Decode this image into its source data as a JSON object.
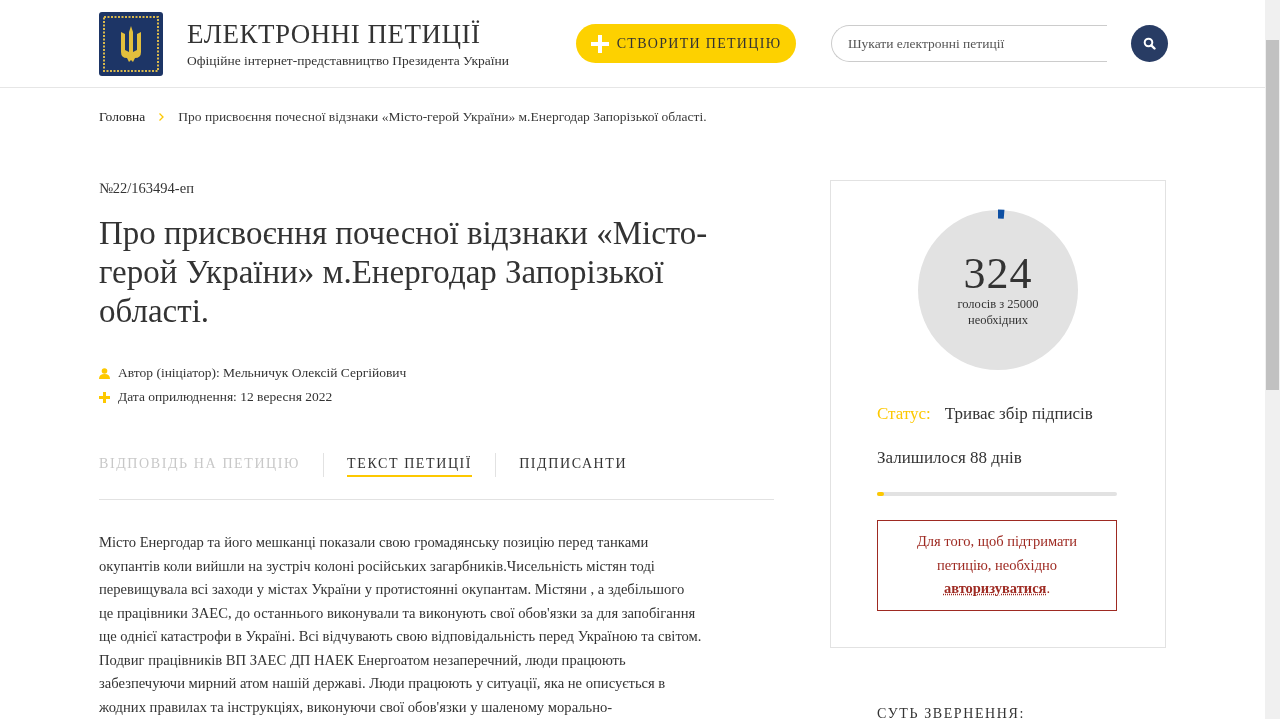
{
  "header": {
    "title": "ЕЛЕКТРОННІ ПЕТИЦІЇ",
    "subtitle": "Офіційне інтернет-представництво Президента України",
    "create_button": "СТВОРИТИ ПЕТИЦІЮ",
    "search": {
      "placeholder": "Шукати електронні петиції"
    }
  },
  "breadcrumbs": [
    {
      "label": "Головна",
      "kind": "link"
    },
    {
      "label": "Про присвоєння почесної відзнаки «Місто-герой України» м.Енергодар Запорізької області.",
      "kind": "current"
    }
  ],
  "petition": {
    "number": "№22/163494-еп",
    "title": "Про присвоєння почесної відзнаки «Місто-герой України» м.Енергодар Запорізької області.",
    "meta": [
      {
        "kind": "author",
        "text": "Автор (ініціатор): Мельничук Олексій Сергійович"
      },
      {
        "kind": "date",
        "text": "Дата оприлюднення: 12 вересня 2022"
      }
    ],
    "tabs": [
      {
        "label": "ВІДПОВІДЬ НА ПЕТИЦІЮ",
        "selected": false,
        "disabled": true
      },
      {
        "label": "ТЕКСТ ПЕТИЦІЇ",
        "selected": true,
        "disabled": false
      },
      {
        "label": "ПІДПИСАНТИ",
        "selected": false,
        "disabled": false
      }
    ],
    "text_lines": [
      "Місто Енергодар та його мешканці показали свою громадянську позицію перед танками",
      "окупантів коли вийшли на зустріч колоні російських загарбників.Чисельність містян тоді",
      "перевищувала всі заходи у містах України у протистоянні окупантам. Містяни , а здебільшого",
      "це працівники ЗАЕС, до останнього виконували та виконують свої обов'язки за для запобігання",
      "ще однієї катастрофи в Україні. Всі відчувають свою відповідальність перед Україною та світом.",
      "Подвиг працівників ВП ЗАЕС ДП НАЕК Енергоатом незаперечний, люди працюють",
      "забезпечуючи мирний атом нашій державі. Люди працюють у ситуації, яка не описується в",
      "жодних правилах та інструкціях, виконуючи свої обов'язки у шаленому морально-"
    ]
  },
  "votes": {
    "count": "324",
    "caption": "голосів з 25000 необхідних",
    "level": 0.013,
    "status_label": "Статус:",
    "status": "Триває збір підписів",
    "remaining": "Залишилося 88 днів",
    "days_bar": {
      "level": 0.03
    },
    "notice": "Для того, щоб підтримати петицію, необхідно",
    "login_link": "авторизуватися",
    "notice_end": "."
  },
  "summary_heading": "СУТЬ ЗВЕРНЕННЯ:"
}
